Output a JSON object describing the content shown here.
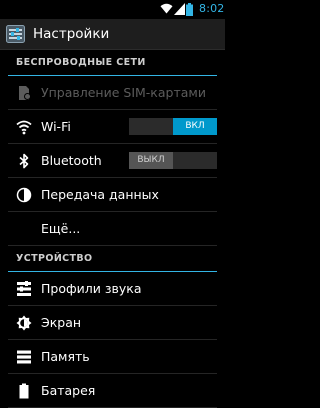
{
  "status_bar": {
    "time": "8:02",
    "time_color": "#33b5e5",
    "icons": [
      "wifi-icon",
      "signal-icon",
      "battery-icon"
    ]
  },
  "action_bar": {
    "title": "Настройки",
    "icon": "settings-app-icon"
  },
  "sections": [
    {
      "label": "БЕСПРОВОДНЫЕ СЕТИ",
      "items": [
        {
          "label": "Управление SIM-картами",
          "icon": "sim-icon",
          "enabled": false
        },
        {
          "label": "Wi-Fi",
          "icon": "wifi-icon",
          "toggle": "ВКЛ",
          "toggle_state": "on"
        },
        {
          "label": "Bluetooth",
          "icon": "bluetooth-icon",
          "toggle": "ВЫКЛ",
          "toggle_state": "off"
        },
        {
          "label": "Передача данных",
          "icon": "data-usage-icon"
        },
        {
          "label": "Ещё...",
          "icon": ""
        }
      ]
    },
    {
      "label": "УСТРОЙСТВО",
      "items": [
        {
          "label": "Профили звука",
          "icon": "audio-profiles-icon"
        },
        {
          "label": "Экран",
          "icon": "display-icon"
        },
        {
          "label": "Память",
          "icon": "storage-icon"
        },
        {
          "label": "Батарея",
          "icon": "battery-icon"
        }
      ]
    }
  ],
  "colors": {
    "accent": "#33b5e5",
    "toggle_on": "#0099cc",
    "background": "#000000"
  }
}
